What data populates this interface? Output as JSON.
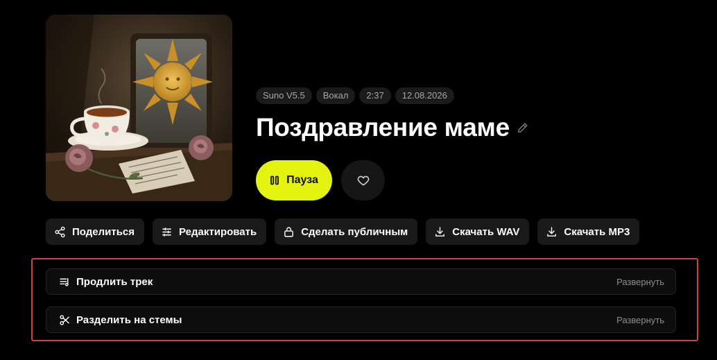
{
  "track": {
    "title": "Поздравление маме",
    "meta_chips": [
      "Suno V5.5",
      "Вокал",
      "2:37",
      "12.08.2026"
    ]
  },
  "player": {
    "play_label": "Пауза",
    "accent_color": "#e3f20f"
  },
  "actions": [
    {
      "label": "Поделиться",
      "icon": "share-icon"
    },
    {
      "label": "Редактировать",
      "icon": "sliders-icon"
    },
    {
      "label": "Сделать публичным",
      "icon": "lock-icon"
    },
    {
      "label": "Скачать WAV",
      "icon": "download-icon"
    },
    {
      "label": "Скачать MP3",
      "icon": "download-icon"
    }
  ],
  "panels": [
    {
      "label": "Продлить трек",
      "expand_label": "Развернуть",
      "icon": "music-list-icon"
    },
    {
      "label": "Разделить на стемы",
      "expand_label": "Развернуть",
      "icon": "scissors-icon"
    }
  ],
  "highlight_color": "#c9443b"
}
